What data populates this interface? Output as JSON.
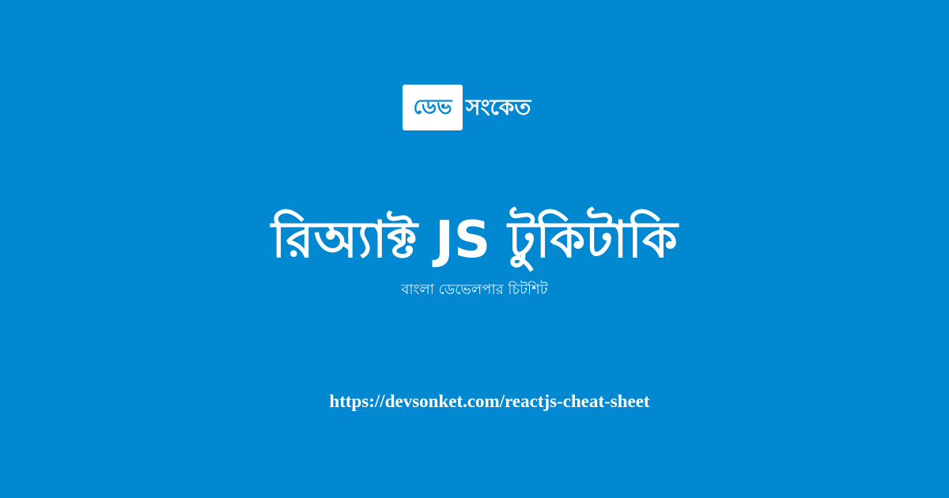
{
  "logo": {
    "badge_text": "ডেভ",
    "word": "সংকেত"
  },
  "title": "রিঅ্যাক্ট JS টুকিটাকি",
  "subtitle": "বাংলা ডেভেলপার চিটশিট",
  "url": "https://devsonket.com/reactjs-cheat-sheet",
  "colors": {
    "background": "#0288d1",
    "text": "#ffffff",
    "badge_background": "#ffffff",
    "badge_text": "#0288d1"
  }
}
